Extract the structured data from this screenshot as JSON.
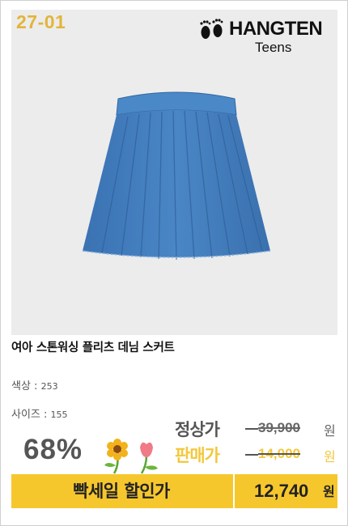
{
  "product": {
    "code": "27-01",
    "brand_name": "HANGTEN",
    "brand_sub": "Teens",
    "title": "여아 스톤워싱 플리츠 데님 스커트",
    "color_label": "색상 : ",
    "color_value": "253",
    "size_label": "사이즈 : ",
    "size_value": "155"
  },
  "pricing": {
    "discount": "68%",
    "regular_label": "정상가",
    "regular_price": "39,900",
    "sale_label": "판매가",
    "sale_price": "14,000",
    "currency": "원"
  },
  "promo": {
    "label": "빡세일 할인가",
    "price": "12,740",
    "currency": "원"
  },
  "colors": {
    "accent_yellow": "#f6c72d",
    "code_gold": "#e2b53a",
    "denim": "#3f7bbd"
  }
}
